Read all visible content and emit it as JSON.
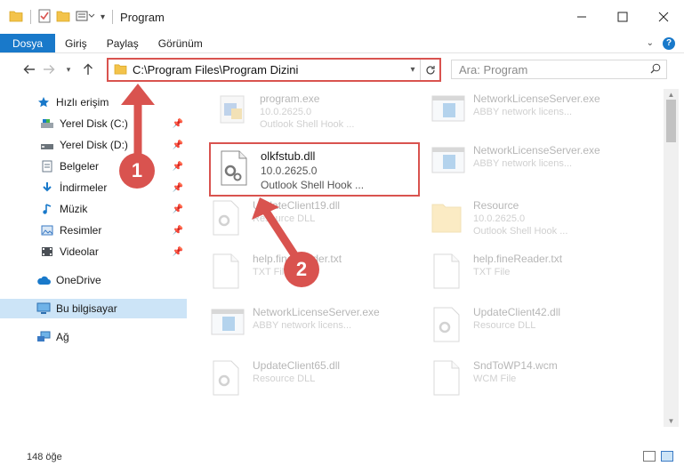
{
  "window": {
    "title": "Program",
    "controls": [
      "minimize",
      "maximize",
      "close"
    ]
  },
  "ribbon": {
    "tabs": [
      "Dosya",
      "Giriş",
      "Paylaş",
      "Görünüm"
    ]
  },
  "address_bar": {
    "path": "C:\\Program Files\\Program Dizini"
  },
  "search": {
    "placeholder": "Ara: Program"
  },
  "sidebar": {
    "items": [
      {
        "label": "Hızlı erişim",
        "icon": "star-icon",
        "pinned": false
      },
      {
        "label": "Yerel Disk (C:)",
        "icon": "drive-icon",
        "pinned": true
      },
      {
        "label": "Yerel Disk (D:)",
        "icon": "drive-icon",
        "pinned": true
      },
      {
        "label": "Belgeler",
        "icon": "documents-icon",
        "pinned": true
      },
      {
        "label": "İndirmeler",
        "icon": "download-icon",
        "pinned": true
      },
      {
        "label": "Müzik",
        "icon": "music-icon",
        "pinned": true
      },
      {
        "label": "Resimler",
        "icon": "pictures-icon",
        "pinned": true
      },
      {
        "label": "Videolar",
        "icon": "videos-icon",
        "pinned": true
      },
      {
        "label": "OneDrive",
        "icon": "cloud-icon",
        "pinned": false
      },
      {
        "label": "Bu bilgisayar",
        "icon": "computer-icon",
        "pinned": false,
        "selected": true
      },
      {
        "label": "Ağ",
        "icon": "network-icon",
        "pinned": false
      }
    ]
  },
  "files": [
    {
      "name": "program.exe",
      "line2": "10.0.2625.0",
      "line3": "Outlook Shell Hook ...",
      "icon": "exe-icon"
    },
    {
      "name": "NetworkLicenseServer.exe",
      "line2": "ABBY network licens...",
      "line3": "",
      "icon": "app-window-icon"
    },
    {
      "name": "olkfstub.dll",
      "line2": "10.0.2625.0",
      "line3": "Outlook Shell Hook ...",
      "icon": "dll-gear-icon",
      "highlighted": true
    },
    {
      "name": "NetworkLicenseServer.exe",
      "line2": "ABBY network licens...",
      "line3": "",
      "icon": "app-window-icon"
    },
    {
      "name": "UpdateClient19.dll",
      "line2": "Resource DLL",
      "line3": "",
      "icon": "dll-icon"
    },
    {
      "name": "Resource",
      "line2": "10.0.2625.0",
      "line3": "Outlook Shell Hook ...",
      "icon": "folder-icon"
    },
    {
      "name": "help.fineReader.txt",
      "line2": "TXT File",
      "line3": "",
      "icon": "txt-icon"
    },
    {
      "name": "help.fineReader.txt",
      "line2": "TXT File",
      "line3": "",
      "icon": "txt-icon"
    },
    {
      "name": "NetworkLicenseServer.exe",
      "line2": "ABBY network licens...",
      "line3": "",
      "icon": "app-window-icon"
    },
    {
      "name": "UpdateClient42.dll",
      "line2": "Resource DLL",
      "line3": "",
      "icon": "dll-icon"
    },
    {
      "name": "UpdateClient65.dll",
      "line2": "Resource DLL",
      "line3": "",
      "icon": "dll-icon"
    },
    {
      "name": "SndToWP14.wcm",
      "line2": "WCM File",
      "line3": "",
      "icon": "wcm-icon"
    }
  ],
  "status": {
    "item_count": "148 öğe"
  },
  "callouts": [
    "1",
    "2"
  ],
  "colors": {
    "accent": "#1979ca",
    "highlight": "#d9534f",
    "selected": "#cce4f7"
  }
}
